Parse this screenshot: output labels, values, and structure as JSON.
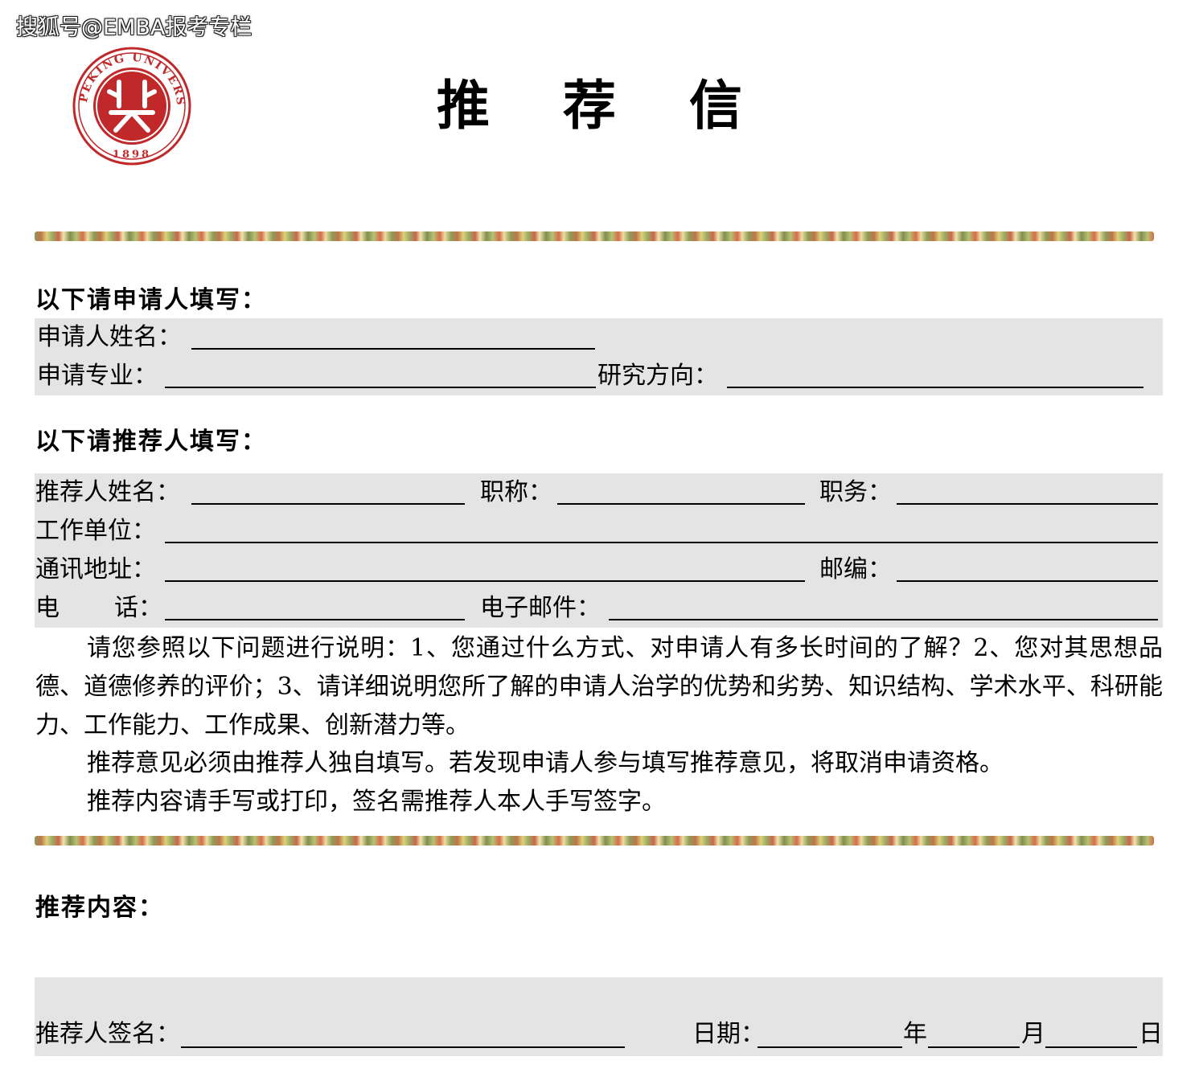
{
  "watermark": "搜狐号@EMBA报考专栏",
  "seal": {
    "ring_text_top": "PEKING UNIVERSITY",
    "year": "1898",
    "color": "#c0282a"
  },
  "title": "推 荐 信",
  "applicant_section": {
    "heading": "以下请申请人填写：",
    "name_label": "申请人姓名：",
    "major_label": "申请专业：",
    "research_label": "研究方向："
  },
  "recommender_section": {
    "heading": "以下请推荐人填写：",
    "name_label": "推荐人姓名：",
    "title_label": "职称：",
    "position_label": "职务：",
    "employer_label": "工作单位：",
    "address_label": "通讯地址：",
    "postcode_label": "邮编：",
    "phone_label_a": "电",
    "phone_label_b": "话：",
    "email_label": "电子邮件："
  },
  "instructions": {
    "para1": "请您参照以下问题进行说明：1、您通过什么方式、对申请人有多长时间的了解？2、您对其思想品德、道德修养的评价；3、请详细说明您所了解的申请人治学的优势和劣势、知识结构、学术水平、科研能力、工作能力、工作成果、创新潜力等。",
    "para2": "推荐意见必须由推荐人独自填写。若发现申请人参与填写推荐意见，将取消申请资格。",
    "para3": "推荐内容请手写或打印，签名需推荐人本人手写签字。"
  },
  "content_section": {
    "heading": "推荐内容："
  },
  "signature": {
    "signature_label": "推荐人签名：",
    "date_label": "日期：",
    "year_label": "年",
    "month_label": "月",
    "day_label": "日"
  },
  "colors": {
    "shade": "#e4e4e4",
    "seal_red": "#c0282a"
  }
}
